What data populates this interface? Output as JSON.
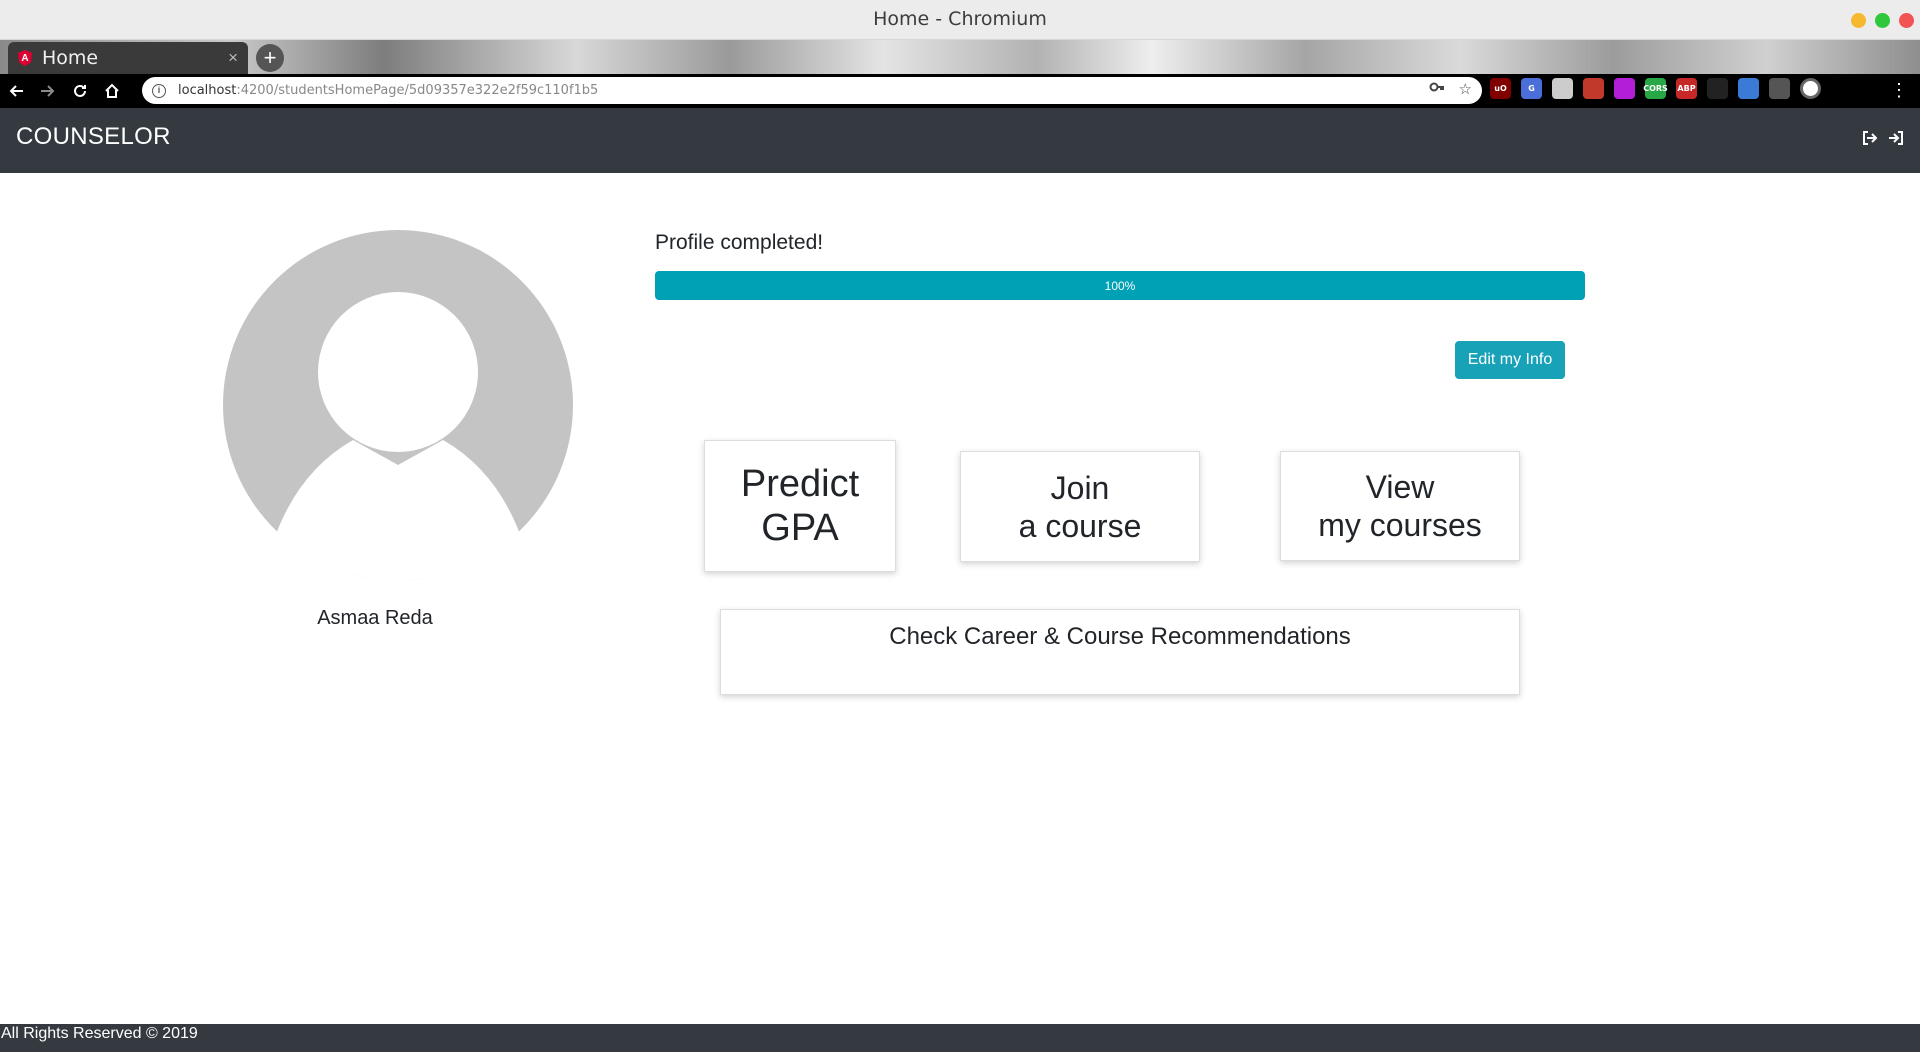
{
  "browser": {
    "window_title": "Home - Chromium",
    "tab_label": "Home",
    "tab_close": "×",
    "new_tab": "+",
    "url_host": "localhost",
    "url_path": ":4200/studentsHomePage/5d09357e322e2f59c110f1b5",
    "extensions": [
      {
        "label": "uO",
        "color": "#800000"
      },
      {
        "label": "G",
        "color": "#4a6fd8"
      },
      {
        "label": "",
        "color": "#cccccc"
      },
      {
        "label": "",
        "color": "#c0392b"
      },
      {
        "label": "",
        "color": "#b21fd6"
      },
      {
        "label": "CORS",
        "color": "#27a745"
      },
      {
        "label": "ABP",
        "color": "#c62828"
      },
      {
        "label": "",
        "color": "#222222"
      },
      {
        "label": "",
        "color": "#3a7bd5"
      },
      {
        "label": "",
        "color": "#555555"
      },
      {
        "label": "",
        "color": "#ffffff"
      }
    ]
  },
  "navbar": {
    "brand": "COUNSELOR"
  },
  "profile": {
    "status_text": "Profile completed!",
    "progress_label": "100%",
    "progress_value": 100,
    "edit_button": "Edit my Info",
    "student_name": "Asmaa Reda"
  },
  "cards": {
    "predict_line1": "Predict",
    "predict_line2": "GPA",
    "join_line1": "Join",
    "join_line2": "a course",
    "view_line1": "View",
    "view_line2": "my courses",
    "check": "Check Career & Course Recommendations"
  },
  "footer": {
    "text": "All Rights Reserved © 2019"
  },
  "colors": {
    "navbar_bg": "#343a40",
    "progress_fill": "#00a0b5",
    "button_accent": "#17a2b8",
    "avatar_gray": "#c4c4c4"
  }
}
